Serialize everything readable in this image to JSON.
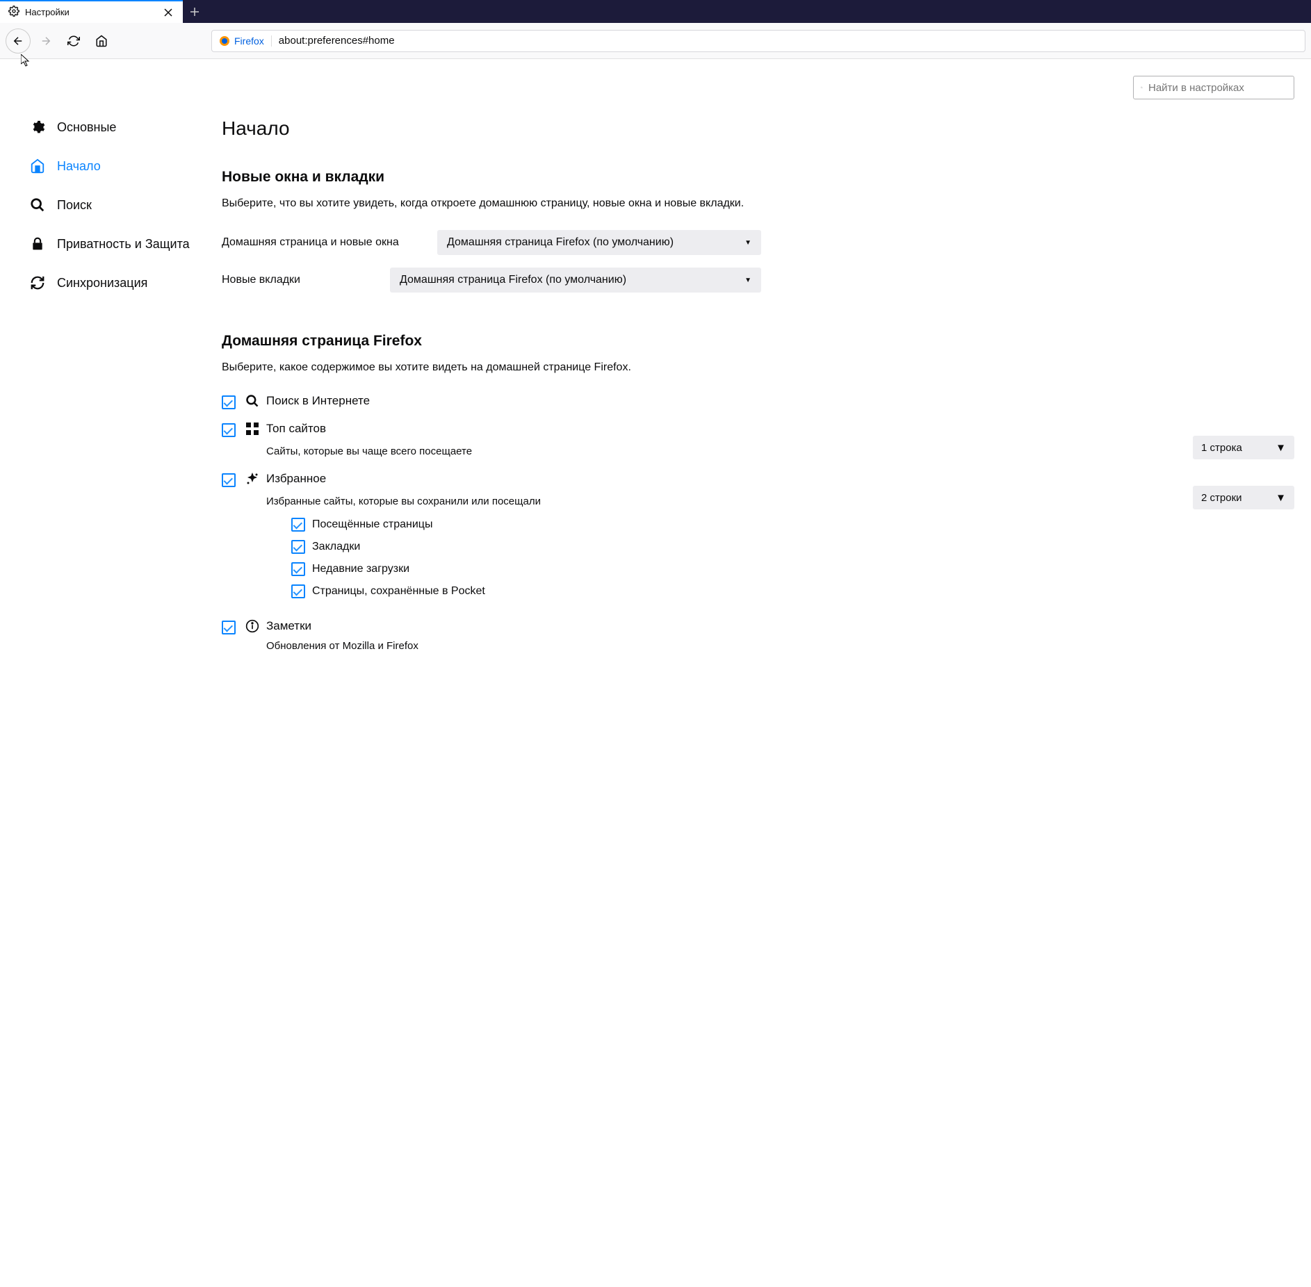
{
  "tab": {
    "title": "Настройки"
  },
  "url": {
    "identity": "Firefox",
    "path": "about:preferences#home"
  },
  "search": {
    "placeholder": "Найти в настройках"
  },
  "sidebar": {
    "items": [
      {
        "label": "Основные"
      },
      {
        "label": "Начало"
      },
      {
        "label": "Поиск"
      },
      {
        "label": "Приватность и Защита"
      },
      {
        "label": "Синхронизация"
      }
    ]
  },
  "page": {
    "title": "Начало",
    "section1": {
      "heading": "Новые окна и вкладки",
      "desc": "Выберите, что вы хотите увидеть, когда откроете домашнюю страницу, новые окна и новые вкладки.",
      "homepage_label": "Домашняя страница и новые окна",
      "homepage_value": "Домашняя страница Firefox (по умолчанию)",
      "newtab_label": "Новые вкладки",
      "newtab_value": "Домашняя страница Firefox (по умолчанию)"
    },
    "section2": {
      "heading": "Домашняя страница Firefox",
      "desc": "Выберите, какое содержимое вы хотите видеть на домашней странице Firefox.",
      "websearch": "Поиск в Интернете",
      "topsites": {
        "title": "Топ сайтов",
        "desc": "Сайты, которые вы чаще всего посещаете",
        "rows": "1 строка"
      },
      "highlights": {
        "title": "Избранное",
        "desc": "Избранные сайты, которые вы сохранили или посещали",
        "rows": "2 строки",
        "sub": [
          "Посещённые страницы",
          "Закладки",
          "Недавние загрузки",
          "Страницы, сохранённые в Pocket"
        ]
      },
      "snippets": {
        "title": "Заметки",
        "desc": "Обновления от Mozilla и Firefox"
      }
    }
  }
}
